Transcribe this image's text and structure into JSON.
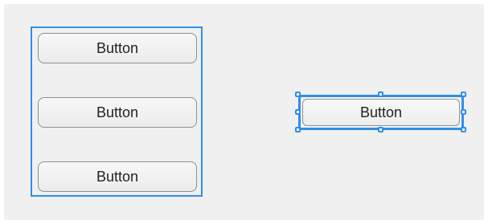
{
  "canvas": {
    "background": "#f0f0f0",
    "selection_color": "#2f8fe8"
  },
  "group": {
    "buttons": [
      {
        "label": "Button"
      },
      {
        "label": "Button"
      },
      {
        "label": "Button"
      }
    ]
  },
  "selected_button": {
    "label": "Button"
  }
}
